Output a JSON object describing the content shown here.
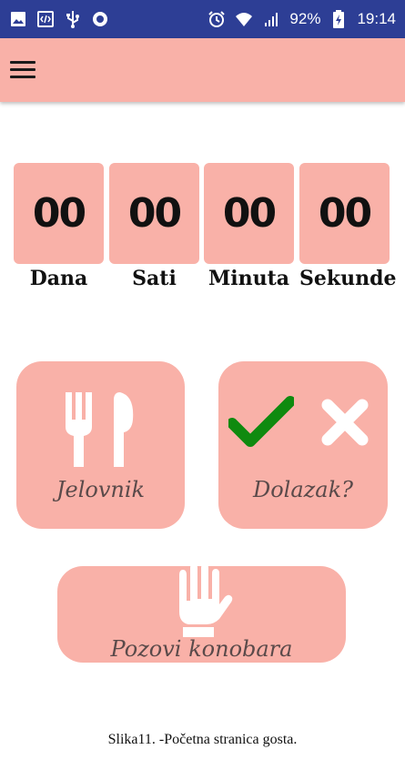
{
  "status_bar": {
    "battery": "92%",
    "time": "19:14",
    "left_icons": [
      "gallery-icon",
      "code-icon",
      "usb-icon",
      "circle-icon"
    ],
    "right_icons": [
      "alarm-icon",
      "wifi-icon",
      "signal-icon",
      "battery-icon"
    ]
  },
  "app_bar": {
    "menu_icon": "hamburger-menu-icon",
    "color": "#f9b1a8"
  },
  "countdown": [
    {
      "value": "00",
      "label": "Dana"
    },
    {
      "value": "00",
      "label": "Sati"
    },
    {
      "value": "00",
      "label": "Minuta"
    },
    {
      "value": "00",
      "label": "Sekunde"
    }
  ],
  "actions": {
    "menu_label": "Jelovnik",
    "menu_icon": "fork-knife-icon",
    "arrival_label": "Dolazak?",
    "arrival_icons": [
      "check-icon",
      "cross-icon"
    ],
    "call_waiter_label": "Pozovi konobara",
    "call_waiter_icon": "hand-icon"
  },
  "colors": {
    "accent": "#f9b1a8",
    "status_bar": "#2d3e95",
    "check": "#0f8a0f"
  },
  "caption": "Slika11. -Početna stranica gosta."
}
